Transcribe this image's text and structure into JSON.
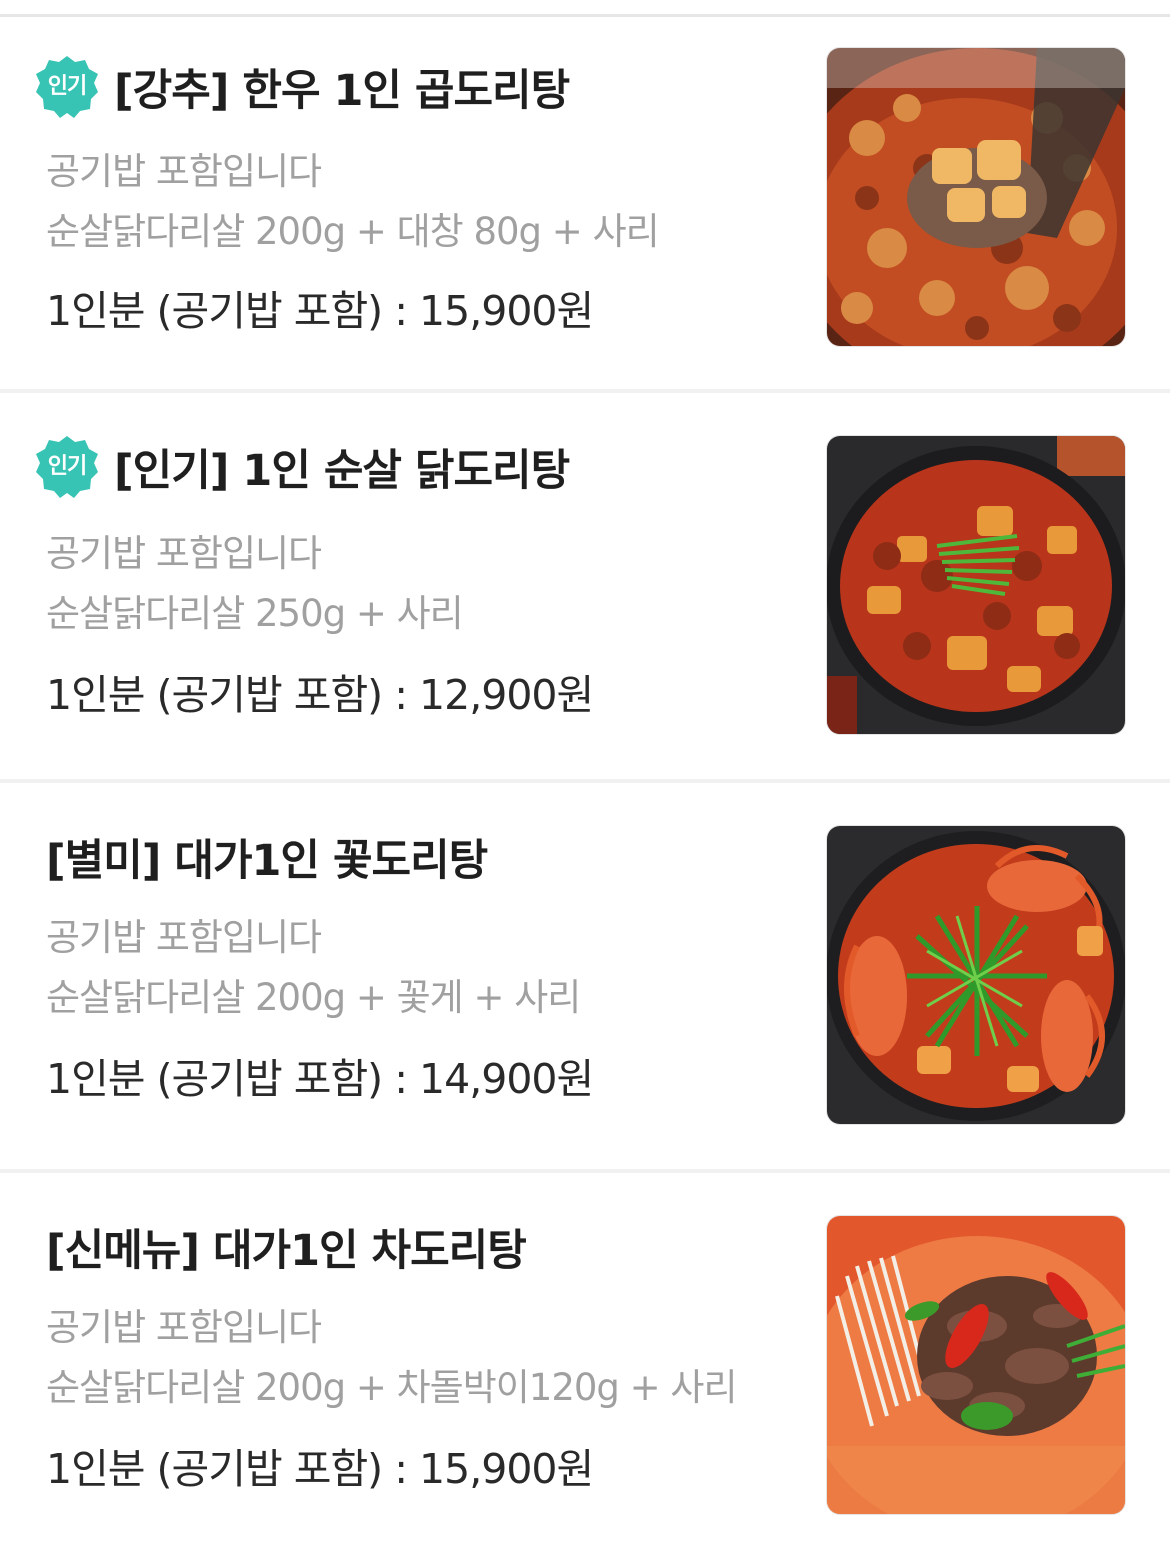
{
  "menu": {
    "items": [
      {
        "badge": "인기",
        "title": "[강추] 한우 1인 곱도리탕",
        "desc_line1": "공기밥 포함입니다",
        "desc_line2": "순살닭다리살 200g + 대창 80g + 사리",
        "price": "1인분 (공기밥 포함) : 15,900원",
        "image": "gopdoritang-photo"
      },
      {
        "badge": "인기",
        "title": "[인기] 1인 순살 닭도리탕",
        "desc_line1": "공기밥 포함입니다",
        "desc_line2": "순살닭다리살 250g + 사리",
        "price": "1인분 (공기밥 포함) : 12,900원",
        "image": "dakdoritang-photo"
      },
      {
        "title": "[별미] 대가1인 꽃도리탕",
        "desc_line1": "공기밥 포함입니다",
        "desc_line2": "순살닭다리살 200g + 꽃게 + 사리",
        "price": "1인분 (공기밥 포함) : 14,900원",
        "image": "kkotdoritang-photo"
      },
      {
        "title": "[신메뉴] 대가1인 차도리탕",
        "desc_line1": "공기밥 포함입니다",
        "desc_line2": "순살닭다리살 200g + 차돌박이120g + 사리",
        "price": "1인분 (공기밥 포함) : 15,900원",
        "image": "chadoritang-photo"
      }
    ]
  },
  "colors": {
    "badge": "#38c4b4",
    "title": "#1f1f1f",
    "description": "#a0a0a0",
    "price": "#2a2a2a",
    "divider": "#f1f1f1"
  }
}
